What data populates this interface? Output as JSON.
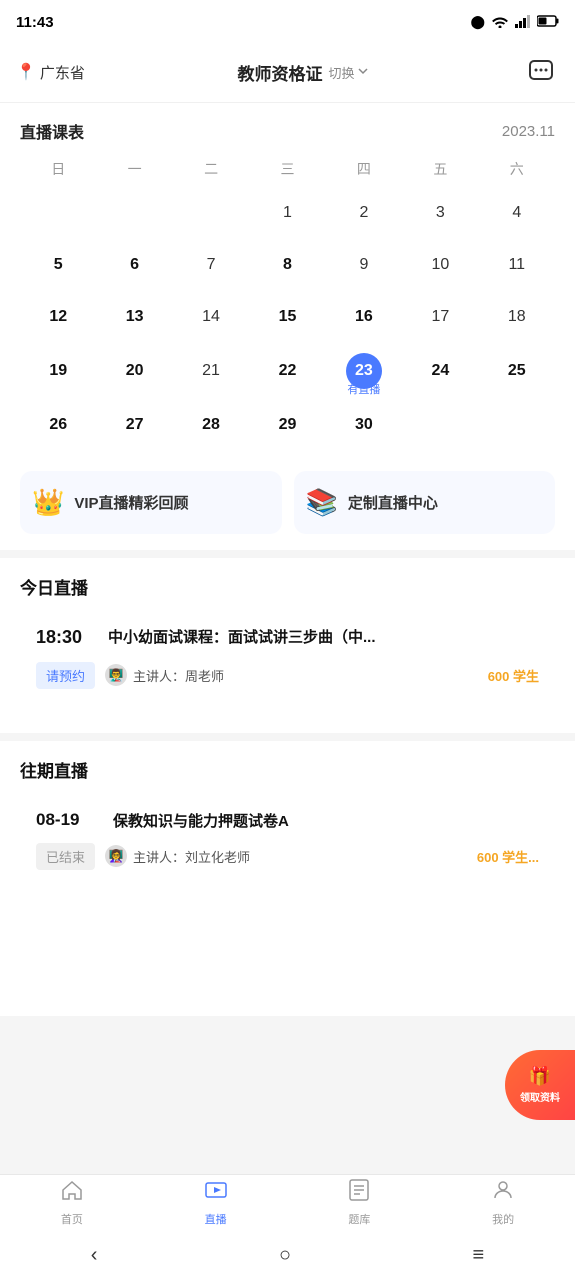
{
  "statusBar": {
    "time": "11:43",
    "icons": [
      "●",
      "WiFi",
      "Signal",
      "Battery"
    ]
  },
  "header": {
    "location": "广东省",
    "title": "教师资格证",
    "switchLabel": "切换",
    "chatIcon": "💬"
  },
  "calendar": {
    "sectionTitle": "直播课表",
    "month": "2023.11",
    "weekdays": [
      "日",
      "一",
      "二",
      "三",
      "四",
      "五",
      "六"
    ],
    "days": [
      {
        "day": "",
        "empty": true
      },
      {
        "day": "",
        "empty": true
      },
      {
        "day": "",
        "empty": true
      },
      {
        "day": "1"
      },
      {
        "day": "2"
      },
      {
        "day": "3"
      },
      {
        "day": "4"
      },
      {
        "day": "5",
        "bold": true
      },
      {
        "day": "6",
        "bold": true
      },
      {
        "day": "7"
      },
      {
        "day": "8",
        "bold": true
      },
      {
        "day": "9"
      },
      {
        "day": "10"
      },
      {
        "day": "11"
      },
      {
        "day": "12",
        "bold": true
      },
      {
        "day": "13",
        "bold": true
      },
      {
        "day": "14"
      },
      {
        "day": "15",
        "bold": true
      },
      {
        "day": "16",
        "bold": true
      },
      {
        "day": "17"
      },
      {
        "day": "18"
      },
      {
        "day": "19",
        "bold": true
      },
      {
        "day": "20",
        "bold": true
      },
      {
        "day": "21"
      },
      {
        "day": "22",
        "bold": true
      },
      {
        "day": "23",
        "today": true,
        "todayLabel": "有直播"
      },
      {
        "day": "24",
        "bold": true
      },
      {
        "day": "25",
        "bold": true
      },
      {
        "day": "26",
        "bold": true
      },
      {
        "day": "27",
        "bold": true
      },
      {
        "day": "28",
        "bold": true
      },
      {
        "day": "29",
        "bold": true
      },
      {
        "day": "30",
        "bold": true
      }
    ]
  },
  "vipCards": [
    {
      "icon": "👑",
      "label": "VIP直播精彩回顾"
    },
    {
      "icon": "📚",
      "label": "定制直播中心"
    }
  ],
  "todayLive": {
    "sectionTitle": "今日直播",
    "card": {
      "time": "18:30",
      "title": "中小幼面试课程：面试试讲三步曲（中...",
      "reserveLabel": "请预约",
      "teacherAvatar": "👨‍🏫",
      "teacherLabel": "主讲人：周老师",
      "studentCount": "600 学生"
    }
  },
  "pastLive": {
    "sectionTitle": "往期直播",
    "card": {
      "date": "08-19",
      "title": "保教知识与能力押题试卷A",
      "endedLabel": "已结束",
      "teacherAvatar": "👩‍🏫",
      "teacherLabel": "主讲人：刘立化老师",
      "studentCount": "600 学生..."
    }
  },
  "floatingBanner": {
    "icon": "🎁",
    "text": "领取资料"
  },
  "bottomNav": {
    "items": [
      {
        "icon": "🏠",
        "label": "首页",
        "active": false
      },
      {
        "icon": "📺",
        "label": "直播",
        "active": true
      },
      {
        "icon": "📝",
        "label": "题库",
        "active": false
      },
      {
        "icon": "👤",
        "label": "我的",
        "active": false
      }
    ]
  },
  "systemNav": {
    "back": "‹",
    "home": "○",
    "menu": "≡"
  }
}
